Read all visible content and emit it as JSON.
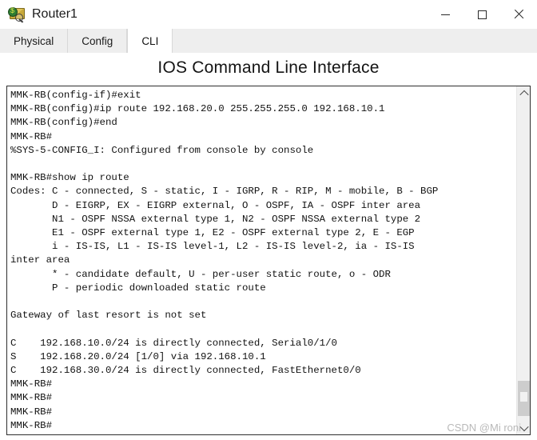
{
  "window": {
    "title": "Router1",
    "icon": "router-packet-icon",
    "controls": {
      "minimize_label": "—",
      "maximize_label": "□",
      "close_label": "✕"
    }
  },
  "tabs": [
    {
      "label": "Physical",
      "active": false
    },
    {
      "label": "Config",
      "active": false
    },
    {
      "label": "CLI",
      "active": true
    }
  ],
  "heading": {
    "title": "IOS Command Line Interface"
  },
  "terminal": {
    "prompt": "MMK-RB#",
    "hostname": "MMK-RB",
    "content": "MMK-RB(config-if)#exit\nMMK-RB(config)#ip route 192.168.20.0 255.255.255.0 192.168.10.1\nMMK-RB(config)#end\nMMK-RB#\n%SYS-5-CONFIG_I: Configured from console by console\n\nMMK-RB#show ip route\nCodes: C - connected, S - static, I - IGRP, R - RIP, M - mobile, B - BGP\n       D - EIGRP, EX - EIGRP external, O - OSPF, IA - OSPF inter area\n       N1 - OSPF NSSA external type 1, N2 - OSPF NSSA external type 2\n       E1 - OSPF external type 1, E2 - OSPF external type 2, E - EGP\n       i - IS-IS, L1 - IS-IS level-1, L2 - IS-IS level-2, ia - IS-IS\ninter area\n       * - candidate default, U - per-user static route, o - ODR\n       P - periodic downloaded static route\n\nGateway of last resort is not set\n\nC    192.168.10.0/24 is directly connected, Serial0/1/0\nS    192.168.20.0/24 [1/0] via 192.168.10.1\nC    192.168.30.0/24 is directly connected, FastEthernet0/0\nMMK-RB#\nMMK-RB#\nMMK-RB#\nMMK-RB#"
  },
  "scrollbar": {
    "up_arrow": "scroll-up",
    "down_arrow": "scroll-down",
    "thumb_position_percent": 88
  },
  "watermark": {
    "text": "CSDN @Mi roni"
  }
}
